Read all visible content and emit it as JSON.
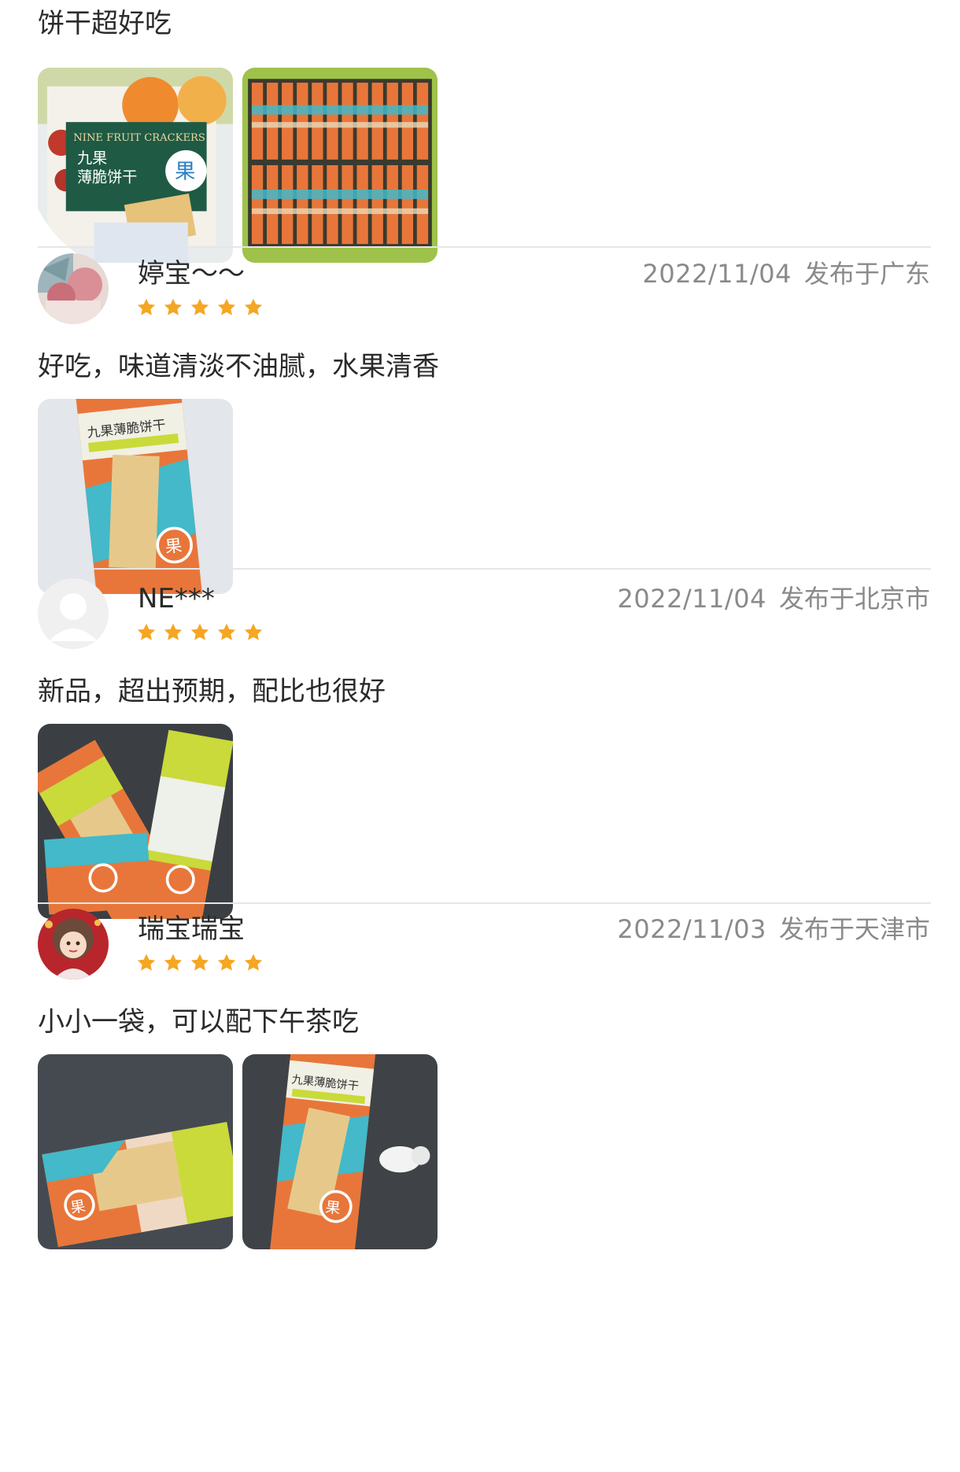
{
  "intro": {
    "text": "饼干超好吃",
    "photos": [
      "product-box-photo",
      "open-box-photo"
    ]
  },
  "reviews": [
    {
      "username": "婷宝～～",
      "date": "2022/11/04",
      "location": "发布于广东",
      "rating": 5,
      "comment": "好吃，味道清淡不油腻，水果清香",
      "photos": [
        "single-pack-photo"
      ]
    },
    {
      "username": "NE***",
      "date": "2022/11/04",
      "location": "发布于北京市",
      "rating": 5,
      "comment": "新品，超出预期，配比也很好",
      "photos": [
        "three-packs-photo"
      ]
    },
    {
      "username": "瑞宝瑞宝",
      "date": "2022/11/03",
      "location": "发布于天津市",
      "rating": 5,
      "comment": "小小一袋，可以配下午茶吃",
      "photos": [
        "pack-flat-photo",
        "pack-standing-photo"
      ]
    }
  ],
  "colors": {
    "star": "#f5a623",
    "meta_text": "#8a8a8a",
    "divider": "#e6e6e6",
    "package_orange": "#e8763a",
    "package_teal": "#43b9c9",
    "package_lime": "#c9da3a"
  }
}
